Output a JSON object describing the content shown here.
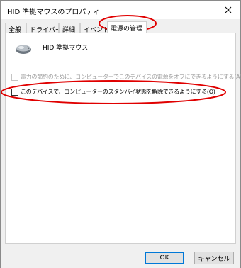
{
  "window": {
    "title": "HID 準拠マウスのプロパティ",
    "close_label": "✕"
  },
  "tabs": [
    {
      "label": "全般",
      "active": false
    },
    {
      "label": "ドライバー",
      "active": false
    },
    {
      "label": "詳細",
      "active": false
    },
    {
      "label": "イベント",
      "active": false
    },
    {
      "label": "電源の管理",
      "active": true
    }
  ],
  "device": {
    "name": "HID 準拠マウス",
    "icon": "mouse-icon"
  },
  "options": [
    {
      "label": "電力の節約のために、コンピューターでこのデバイスの電源をオフにできるようにする(A)",
      "checked": false,
      "enabled": false
    },
    {
      "label": "このデバイスで、コンピューターのスタンバイ状態を解除できるようにする(O)",
      "checked": false,
      "enabled": true
    }
  ],
  "buttons": {
    "ok": "OK",
    "cancel": "キャンセル"
  },
  "annotation_color": "#e00000"
}
